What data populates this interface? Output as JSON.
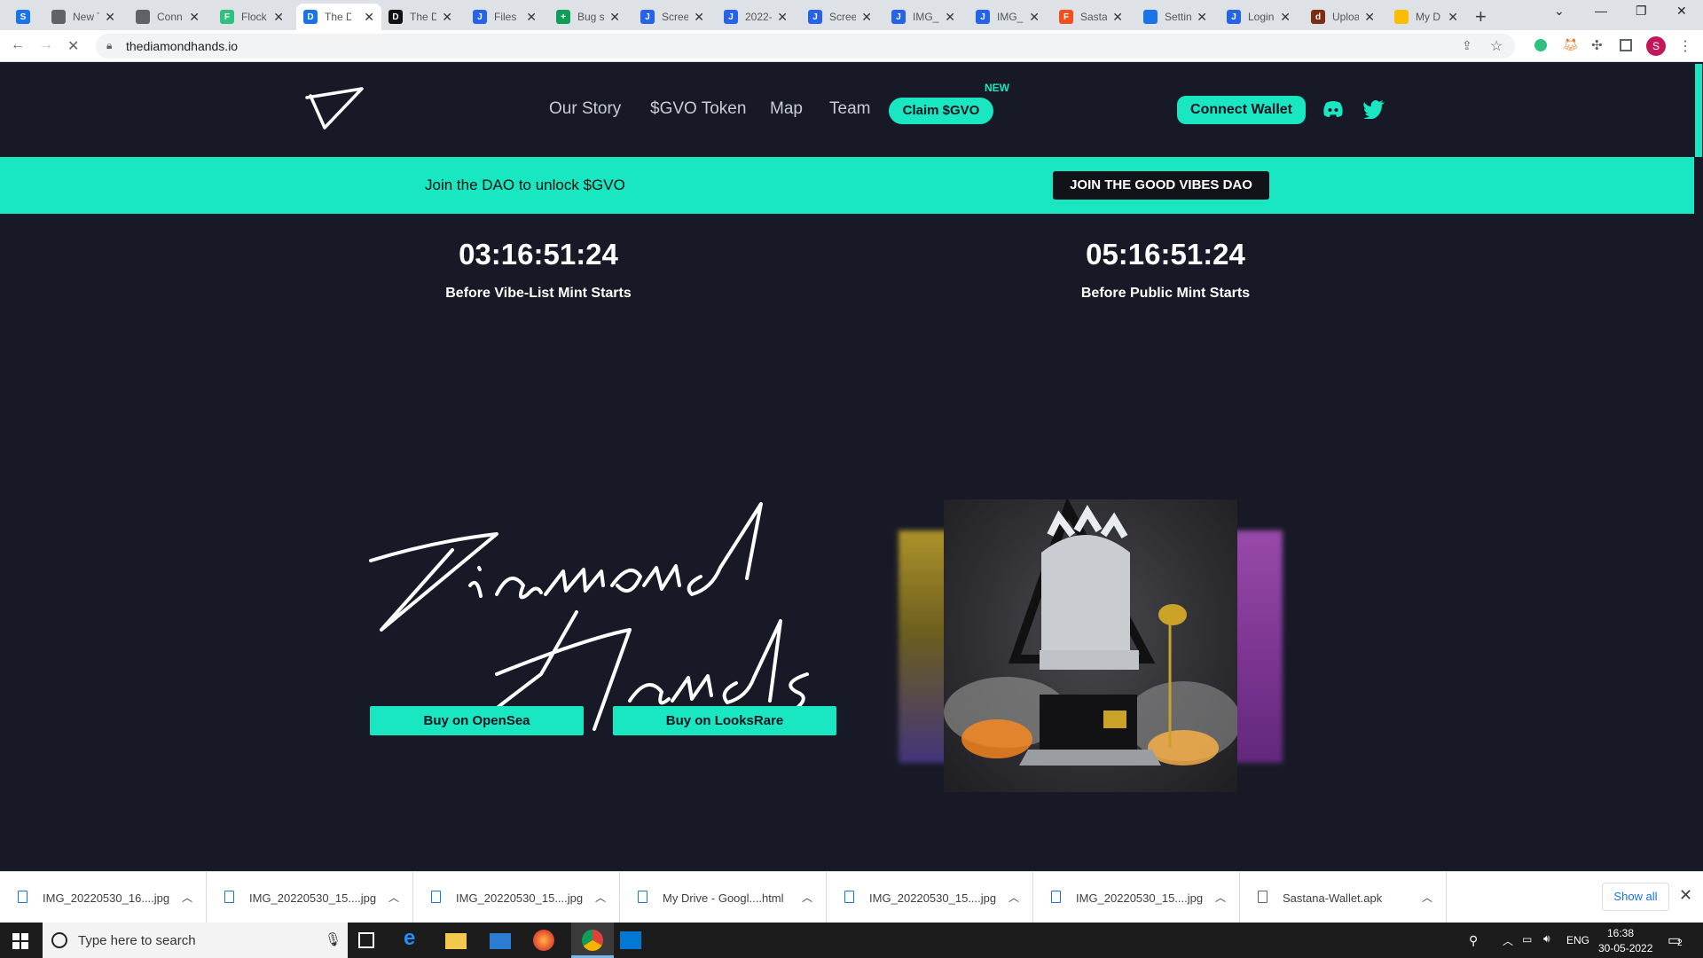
{
  "browser": {
    "tabs": [
      {
        "label": "",
        "favicon": "S",
        "color": "#1a73e8"
      },
      {
        "label": "New T",
        "favicon": "chrome",
        "color": "#5f6368"
      },
      {
        "label": "Conn",
        "favicon": "globe",
        "color": "#5f6368"
      },
      {
        "label": "Flock",
        "favicon": "F",
        "color": "#2ec27e"
      },
      {
        "label": "The D",
        "favicon": "D",
        "color": "#1a73e8",
        "active": true
      },
      {
        "label": "The D",
        "favicon": "D",
        "color": "#111111"
      },
      {
        "label": "Files",
        "favicon": "J",
        "color": "#2563eb"
      },
      {
        "label": "Bug s",
        "favicon": "+",
        "color": "#0f9d58"
      },
      {
        "label": "Scree",
        "favicon": "J",
        "color": "#2563eb"
      },
      {
        "label": "2022-",
        "favicon": "J",
        "color": "#2563eb"
      },
      {
        "label": "Scree",
        "favicon": "J",
        "color": "#2563eb"
      },
      {
        "label": "IMG_",
        "favicon": "J",
        "color": "#2563eb"
      },
      {
        "label": "IMG_",
        "favicon": "J",
        "color": "#2563eb"
      },
      {
        "label": "Sasta",
        "favicon": "F",
        "color": "#f24e1e"
      },
      {
        "label": "Settin",
        "favicon": "gear",
        "color": "#1a73e8"
      },
      {
        "label": "Login",
        "favicon": "J",
        "color": "#2563eb"
      },
      {
        "label": "Uploa",
        "favicon": "d",
        "color": "#7c2d12"
      },
      {
        "label": "My D",
        "favicon": "drive",
        "color": "#fbbc04"
      }
    ],
    "url": "thediamondhands.io"
  },
  "nav": {
    "links": [
      "Our Story",
      "$GVO Token",
      "Map",
      "Team"
    ],
    "claim_label": "Claim $GVO",
    "new_badge": "NEW",
    "connect_label": "Connect Wallet"
  },
  "banner": {
    "text": "Join the DAO to unlock $GVO",
    "button": "JOIN THE GOOD VIBES DAO"
  },
  "timers": [
    {
      "value": "03:16:51:24",
      "label": "Before Vibe-List Mint Starts"
    },
    {
      "value": "05:16:51:24",
      "label": "Before Public Mint Starts"
    }
  ],
  "hero": {
    "buttons": [
      "Buy on OpenSea",
      "Buy on LooksRare"
    ]
  },
  "downloads": {
    "items": [
      "IMG_20220530_16....jpg",
      "IMG_20220530_15....jpg",
      "IMG_20220530_15....jpg",
      "My Drive - Googl....html",
      "IMG_20220530_15....jpg",
      "IMG_20220530_15....jpg",
      "Sastana-Wallet.apk"
    ],
    "show_all": "Show all"
  },
  "taskbar": {
    "search_placeholder": "Type here to search",
    "lang": "ENG",
    "time": "16:38",
    "date": "30-05-2022",
    "notif_count": "2"
  },
  "colors": {
    "accent": "#18e7c1",
    "page_bg": "#171a26"
  }
}
